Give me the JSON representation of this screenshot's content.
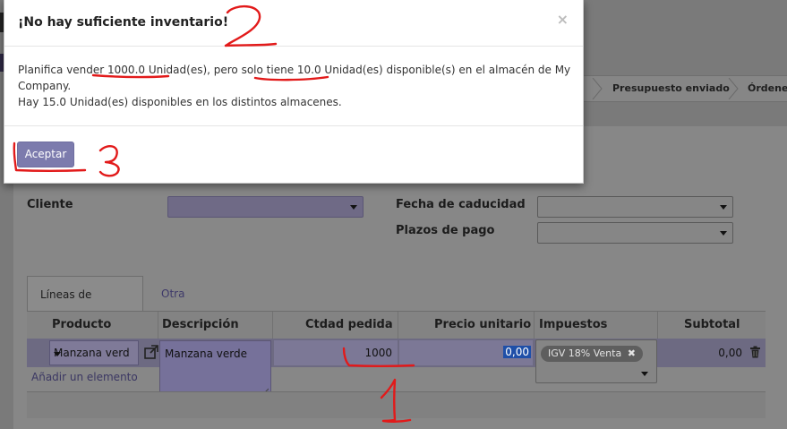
{
  "statusbar": {
    "steps": [
      "Presupuesto enviado",
      "Órdenes"
    ]
  },
  "form": {
    "cliente_label": "Cliente",
    "fecha_label": "Fecha de caducidad",
    "plazos_label": "Plazos de pago"
  },
  "tabs": [
    {
      "label": "Líneas de Pedido",
      "active": true
    },
    {
      "label": "Otra información",
      "active": false
    }
  ],
  "table": {
    "headers": [
      "Producto",
      "Descripción",
      "Ctdad pedida",
      "Precio unitario",
      "Impuestos",
      "Subtotal"
    ],
    "row": {
      "producto": "Manzana verd",
      "descripcion": "Manzana verde",
      "cantidad": "1000",
      "precio": "0,00",
      "impuesto_tag": "IGV 18% Venta",
      "subtotal": "0,00"
    },
    "add_line": "Añadir un elemento"
  },
  "modal": {
    "title": "¡No hay suficiente inventario!",
    "close_glyph": "×",
    "line1": "Planifica vender 1000.0 Unidad(es), pero solo tiene 10.0 Unidad(es) disponible(s) en el almacén de My Company.",
    "line2": "Hay 15.0 Unidad(es) disponibles en los distintos almacenes.",
    "accept_label": "Aceptar"
  },
  "annotations": {
    "color": "#e21a1a",
    "numbers": [
      "1",
      "2",
      "3"
    ]
  },
  "colors": {
    "primary": "#7c7bad",
    "overlay": "#7a7a7a"
  }
}
